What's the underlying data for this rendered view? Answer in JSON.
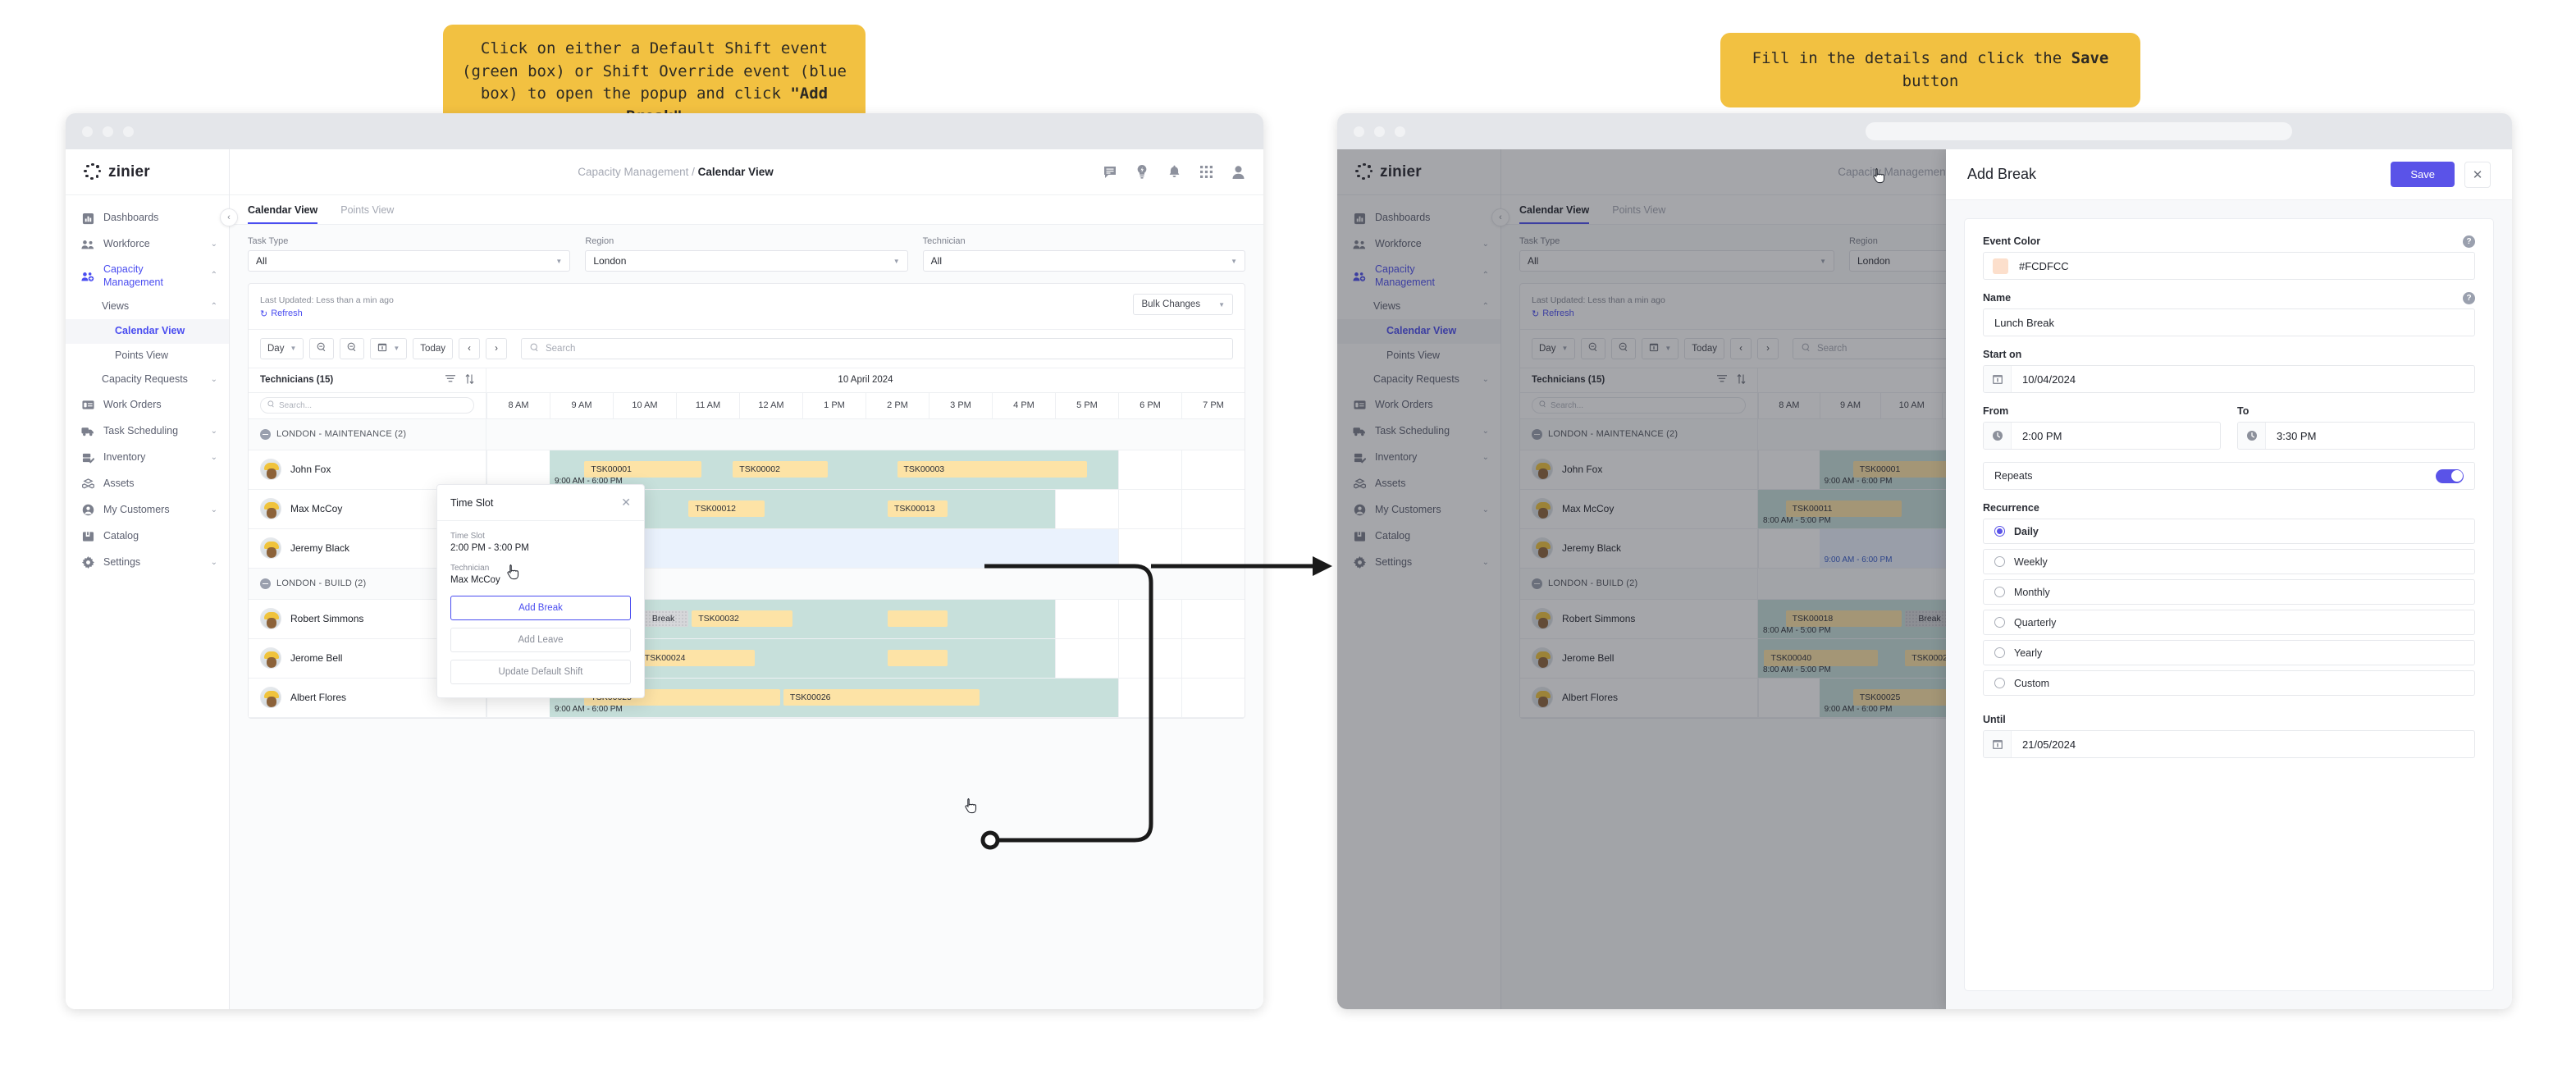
{
  "callouts": {
    "left_pre": "Click on either a Default Shift event (green box) or Shift Override event (blue box) to open the popup and click ",
    "left_bold": "\"Add Break\"",
    "right_pre": "Fill in the details and click the ",
    "right_bold": "Save",
    "right_post": " button"
  },
  "brand": {
    "name": "zinier"
  },
  "sidebar": {
    "items": [
      {
        "label": "Dashboards",
        "icon": "dashboard-icon",
        "chevron": ""
      },
      {
        "label": "Workforce",
        "icon": "workforce-icon",
        "chevron": "⌄"
      },
      {
        "label": "Capacity Management",
        "icon": "capacity-icon",
        "chevron": "⌃"
      },
      {
        "label": "Views",
        "icon": "",
        "chevron": "⌃"
      },
      {
        "label": "Calendar View",
        "icon": "",
        "chevron": ""
      },
      {
        "label": "Points View",
        "icon": "",
        "chevron": ""
      },
      {
        "label": "Capacity Requests",
        "icon": "",
        "chevron": "⌄"
      },
      {
        "label": "Work Orders",
        "icon": "work-orders-icon",
        "chevron": ""
      },
      {
        "label": "Task Scheduling",
        "icon": "task-scheduling-icon",
        "chevron": "⌄"
      },
      {
        "label": "Inventory",
        "icon": "inventory-icon",
        "chevron": "⌄"
      },
      {
        "label": "Assets",
        "icon": "assets-icon",
        "chevron": ""
      },
      {
        "label": "My Customers",
        "icon": "customers-icon",
        "chevron": "⌄"
      },
      {
        "label": "Catalog",
        "icon": "catalog-icon",
        "chevron": ""
      },
      {
        "label": "Settings",
        "icon": "settings-icon",
        "chevron": "⌄"
      }
    ]
  },
  "header": {
    "breadcrumb_parent": "Capacity Management",
    "breadcrumb_sep": "/",
    "breadcrumb_current": "Calendar View",
    "icons": [
      "feedback-icon",
      "idea-icon",
      "bell-icon",
      "apps-grid-icon",
      "user-avatar-icon"
    ]
  },
  "tabs": [
    {
      "label": "Calendar View",
      "active": true
    },
    {
      "label": "Points View",
      "active": false
    }
  ],
  "filters": [
    {
      "label": "Task Type",
      "value": "All"
    },
    {
      "label": "Region",
      "value": "London"
    },
    {
      "label": "Technician",
      "value": "All"
    }
  ],
  "panel": {
    "last_updated": "Last Updated: Less than a min ago",
    "refresh": "Refresh",
    "bulk_changes": "Bulk Changes"
  },
  "toolbar": {
    "view": "Day",
    "zoom_out": "zoom-out-icon",
    "zoom_in": "zoom-in-icon",
    "calendar": "calendar-icon",
    "today": "Today",
    "prev": "‹",
    "next": "›",
    "search_placeholder": "Search"
  },
  "calendar": {
    "left_header": "Technicians (15)",
    "filter_icon": "filter-icon",
    "sort_icon": "sort-icon",
    "date": "10 April 2024",
    "search_placeholder": "Search...",
    "hours": [
      "8 AM",
      "9 AM",
      "10 AM",
      "11 AM",
      "12 AM",
      "1 PM",
      "2 PM",
      "3 PM",
      "4 PM",
      "5 PM",
      "6 PM",
      "7 PM"
    ],
    "groups": [
      {
        "label": "LONDON - MAINTENANCE (2)",
        "rows": [
          {
            "name": "John Fox",
            "shift_type": "green",
            "shift_label": "9:00 AM - 6:00 PM",
            "shift_start": 1,
            "shift_span": 9,
            "tasks": [
              {
                "id": "TSK00001",
                "start": 1.55,
                "span": 1.85
              },
              {
                "id": "TSK00002",
                "start": 3.9,
                "span": 1.5
              },
              {
                "id": "TSK00003",
                "start": 6.5,
                "span": 3.0
              }
            ]
          },
          {
            "name": "Max McCoy",
            "shift_type": "green",
            "shift_label": "8:00 AM - 5:00 PM",
            "shift_start": 0,
            "shift_span": 9,
            "tasks": [
              {
                "id": "TSK00011",
                "start": 0.45,
                "span": 1.9
              },
              {
                "id": "TSK00012",
                "start": 3.2,
                "span": 1.2
              },
              {
                "id": "TSK00013",
                "start": 6.35,
                "span": 0.95
              }
            ]
          },
          {
            "name": "Jeremy Black",
            "shift_type": "blue",
            "shift_label": "9:00 AM - 6:00 PM",
            "shift_start": 1,
            "shift_span": 9,
            "tasks": []
          }
        ]
      },
      {
        "label": "LONDON - BUILD (2)",
        "rows": [
          {
            "name": "Robert Simmons",
            "shift_type": "green",
            "shift_label": "8:00 AM - 5:00 PM",
            "shift_start": 0,
            "shift_span": 9,
            "tasks": [
              {
                "id": "TSK00018",
                "start": 0.45,
                "span": 1.9
              },
              {
                "id": "Break",
                "start": 2.4,
                "span": 0.8,
                "break": true
              },
              {
                "id": "TSK00032",
                "start": 3.25,
                "span": 1.6
              },
              {
                "id": "",
                "start": 6.35,
                "span": 0.95
              }
            ]
          },
          {
            "name": "Jerome Bell",
            "shift_type": "green",
            "shift_label": "8:00 AM - 5:00 PM",
            "shift_start": 0,
            "shift_span": 9,
            "tasks": [
              {
                "id": "TSK00040",
                "start": 0.1,
                "span": 1.85
              },
              {
                "id": "TSK00024",
                "start": 2.4,
                "span": 1.85
              },
              {
                "id": "",
                "start": 6.35,
                "span": 0.95
              }
            ]
          },
          {
            "name": "Albert Flores",
            "shift_type": "green",
            "shift_label": "9:00 AM - 6:00 PM",
            "shift_start": 1,
            "shift_span": 9,
            "tasks": [
              {
                "id": "TSK00025",
                "start": 1.55,
                "span": 3.1
              },
              {
                "id": "TSK00026",
                "start": 4.7,
                "span": 3.1
              }
            ]
          }
        ]
      }
    ]
  },
  "popup": {
    "title": "Time Slot",
    "close_icon": "close-icon",
    "time_slot_label": "Time Slot",
    "time_slot_value": "2:00 PM - 3:00 PM",
    "technician_label": "Technician",
    "technician_value": "Max McCoy",
    "add_break": "Add Break",
    "add_leave": "Add Leave",
    "update_default_shift": "Update Default Shift"
  },
  "drawer": {
    "title": "Add Break",
    "save_label": "Save",
    "close_icon": "close-icon",
    "fields": {
      "event_color_label": "Event Color",
      "event_color_value": "#FCDFCC",
      "event_color_swatch": "#FCDFCC",
      "name_label": "Name",
      "name_value": "Lunch Break",
      "start_on_label": "Start on",
      "start_on_value": "10/04/2024",
      "from_label": "From",
      "from_value": "2:00 PM",
      "to_label": "To",
      "to_value": "3:30 PM",
      "repeats_label": "Repeats",
      "repeats_on": true,
      "recurrence_label": "Recurrence",
      "recurrence_options": [
        {
          "label": "Daily",
          "selected": true
        },
        {
          "label": "Weekly",
          "selected": false
        },
        {
          "label": "Monthly",
          "selected": false
        },
        {
          "label": "Quarterly",
          "selected": false
        },
        {
          "label": "Yearly",
          "selected": false
        },
        {
          "label": "Custom",
          "selected": false
        }
      ],
      "until_label": "Until",
      "until_value": "21/05/2024"
    }
  },
  "colors": {
    "accent": "#5a53e8",
    "callout": "#f2c141",
    "shift_green": "#c7e0db",
    "shift_blue": "#eaf2fd",
    "task_yellow": "#fde3a6",
    "break_gray": "#d6d7da"
  }
}
